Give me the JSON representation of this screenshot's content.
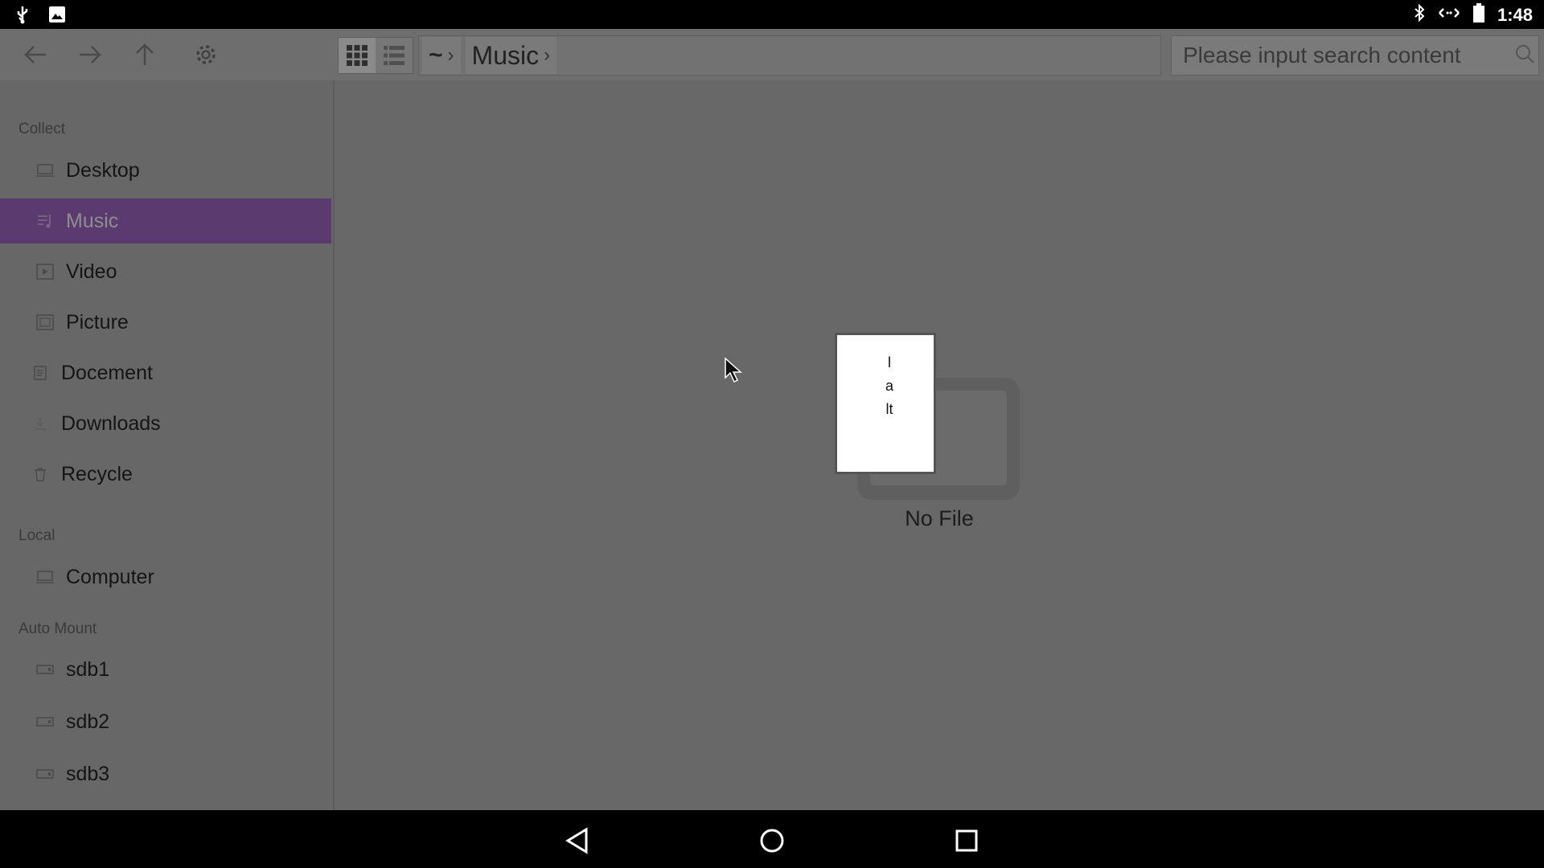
{
  "status_bar": {
    "time": "1:48",
    "left_icons": [
      "usb-icon",
      "image-icon"
    ],
    "right_icons": [
      "bluetooth-icon",
      "data-transfer-icon",
      "battery-icon"
    ]
  },
  "toolbar": {
    "back_icon": "arrow-left-icon",
    "forward_icon": "arrow-right-icon",
    "up_icon": "arrow-up-icon",
    "settings_icon": "gear-icon",
    "view_modes": [
      "grid-view-icon",
      "list-view-icon"
    ],
    "active_view": "grid",
    "breadcrumb": [
      {
        "label": "~"
      },
      {
        "label": "Music"
      }
    ],
    "search_placeholder": "Please input search content",
    "search_value": ""
  },
  "sidebar": {
    "sections": [
      {
        "title": "Collect",
        "items": [
          {
            "label": "Desktop",
            "icon": "desktop-icon"
          },
          {
            "label": "Music",
            "icon": "music-icon",
            "selected": true
          },
          {
            "label": "Video",
            "icon": "video-icon"
          },
          {
            "label": "Picture",
            "icon": "picture-icon"
          },
          {
            "label": "Docement",
            "icon": "document-icon"
          },
          {
            "label": "Downloads",
            "icon": "download-icon"
          },
          {
            "label": "Recycle",
            "icon": "trash-icon"
          }
        ]
      },
      {
        "title": "Local",
        "items": [
          {
            "label": "Computer",
            "icon": "computer-icon"
          }
        ]
      },
      {
        "title": "Auto Mount",
        "items": [
          {
            "label": "sdb1",
            "icon": "drive-icon"
          },
          {
            "label": "sdb2",
            "icon": "drive-icon"
          },
          {
            "label": "sdb3",
            "icon": "drive-icon"
          }
        ]
      }
    ]
  },
  "main": {
    "empty_text": "No File",
    "empty_icon": "empty-folder-icon"
  },
  "popup": {
    "text": "lalt"
  },
  "nav_bar": {
    "buttons": [
      "back-triangle-icon",
      "home-circle-icon",
      "recents-square-icon"
    ]
  },
  "colors": {
    "selected_background": "#5b3a70",
    "dim_overlay": "#686868"
  }
}
